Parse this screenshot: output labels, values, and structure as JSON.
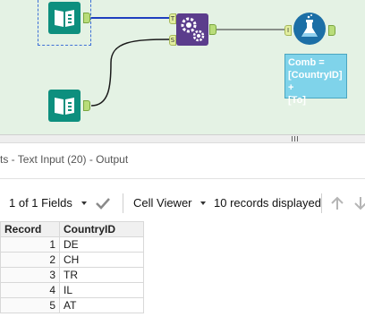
{
  "workflow": {
    "annotation": [
      "Comb =",
      "[CountryID] +",
      "[To]"
    ],
    "anchors": {
      "target": "T",
      "source": "S",
      "input": "I"
    },
    "icons": {
      "text_input_top": "book-icon",
      "text_input_bottom": "book-icon",
      "append_tool": "gears-icon",
      "formula_tool": "flask-icon"
    },
    "colors": {
      "canvas": "#e4f2e4",
      "wire_selected": "#1f3fbf",
      "text_input": "#0d8f7e",
      "append": "#5b3d8c",
      "formula": "#1c6fa6"
    }
  },
  "results": {
    "panel_title": "ts - Text Input (20) - Output",
    "fields_label": "1 of 1 Fields",
    "cell_viewer_label": "Cell Viewer",
    "records_label": "10 records displayed",
    "columns": [
      "Record",
      "CountryID"
    ],
    "rows": [
      {
        "record": "1",
        "value": "DE"
      },
      {
        "record": "2",
        "value": "CH"
      },
      {
        "record": "3",
        "value": "TR"
      },
      {
        "record": "4",
        "value": "IL"
      },
      {
        "record": "5",
        "value": "AT"
      }
    ]
  }
}
